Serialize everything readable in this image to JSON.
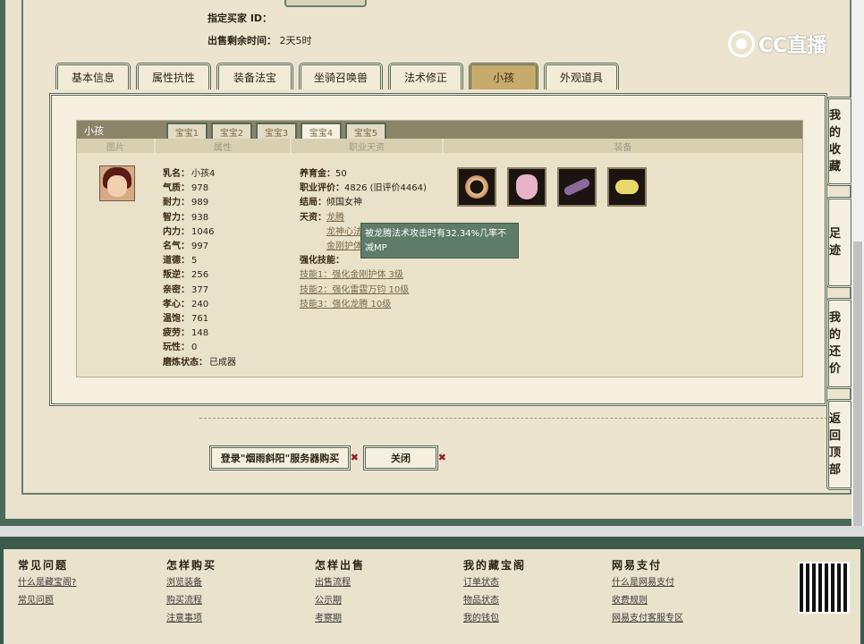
{
  "header": {
    "buyer_label": "指定买家 ID：",
    "remaining_label": "出售剩余时间：",
    "remaining_value": "2天5时",
    "logo_text": "CC直播"
  },
  "tabs": [
    {
      "label": "基本信息"
    },
    {
      "label": "属性抗性"
    },
    {
      "label": "装备法宝"
    },
    {
      "label": "坐骑召唤兽"
    },
    {
      "label": "法术修正"
    },
    {
      "label": "小孩"
    },
    {
      "label": "外观道具"
    }
  ],
  "child_panel": {
    "title": "小孩",
    "baby_tabs": [
      "宝宝1",
      "宝宝2",
      "宝宝3",
      "宝宝4",
      "宝宝5"
    ],
    "columns": [
      "图片",
      "属性",
      "职业天资",
      "装备"
    ],
    "attributes": [
      {
        "label": "乳名：",
        "value": "小孩4"
      },
      {
        "label": "气质：",
        "value": "978"
      },
      {
        "label": "耐力：",
        "value": "989"
      },
      {
        "label": "智力：",
        "value": "938"
      },
      {
        "label": "内力：",
        "value": "1046"
      },
      {
        "label": "名气：",
        "value": "997"
      },
      {
        "label": "道德：",
        "value": "5"
      },
      {
        "label": "叛逆：",
        "value": "256"
      },
      {
        "label": "亲密：",
        "value": "377"
      },
      {
        "label": "孝心：",
        "value": "240"
      },
      {
        "label": "温饱：",
        "value": "761"
      },
      {
        "label": "疲劳：",
        "value": "148"
      },
      {
        "label": "玩性：",
        "value": "0"
      },
      {
        "label": "磨炼状态：",
        "value": "已成器"
      }
    ],
    "career": {
      "fee_label": "养育金：",
      "fee_value": "50",
      "eval_label": "职业评价：",
      "eval_value": "4826 (旧评价4464)",
      "ending_label": "结局：",
      "ending_value": "倾国女神",
      "talent_label": "天资：",
      "talents": [
        "龙腾",
        "龙神心法",
        "金刚护体"
      ],
      "skills_label": "强化技能：",
      "skills": [
        "技能1：强化金刚护体 3级",
        "技能2：强化雷霆万钧 10级",
        "技能3：强化龙腾 10级"
      ]
    },
    "tooltip": "被龙腾法术攻击时有32.34%几率不减MP"
  },
  "actions": {
    "login_buy": "登录\"烟雨斜阳\"服务器购买",
    "close": "关闭"
  },
  "side_buttons": [
    "我的收藏",
    "足迹",
    "我的还价",
    "返回顶部"
  ],
  "footer": {
    "columns": [
      {
        "heading": "常见问题",
        "links": [
          "什么是藏宝阁?",
          "常见问题"
        ]
      },
      {
        "heading": "怎样购买",
        "links": [
          "浏览装备",
          "购买流程",
          "注意事项"
        ]
      },
      {
        "heading": "怎样出售",
        "links": [
          "出售流程",
          "公示期",
          "考察期"
        ]
      },
      {
        "heading": "我的藏宝阁",
        "links": [
          "订单状态",
          "物品状态",
          "我的钱包"
        ]
      },
      {
        "heading": "网易支付",
        "links": [
          "什么是网易支付",
          "收费规则",
          "网易支付客服专区"
        ]
      }
    ]
  }
}
